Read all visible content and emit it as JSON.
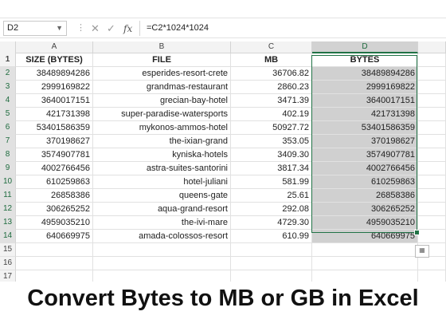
{
  "formula_bar": {
    "name_box": "D2",
    "cancel_icon": "✕",
    "enter_icon": "✓",
    "fx_label": "fx",
    "formula": "=C2*1024*1024"
  },
  "columns": [
    "A",
    "B",
    "C",
    "D"
  ],
  "headers": {
    "a": "SIZE (BYTES)",
    "b": "FILE",
    "c": "MB",
    "d": "BYTES"
  },
  "rows": [
    {
      "n": "2",
      "a": "38489894286",
      "b": "esperides-resort-crete",
      "c": "36706.82",
      "d": "38489894286"
    },
    {
      "n": "3",
      "a": "2999169822",
      "b": "grandmas-restaurant",
      "c": "2860.23",
      "d": "2999169822"
    },
    {
      "n": "4",
      "a": "3640017151",
      "b": "grecian-bay-hotel",
      "c": "3471.39",
      "d": "3640017151"
    },
    {
      "n": "5",
      "a": "421731398",
      "b": "super-paradise-watersports",
      "c": "402.19",
      "d": "421731398"
    },
    {
      "n": "6",
      "a": "53401586359",
      "b": "mykonos-ammos-hotel",
      "c": "50927.72",
      "d": "53401586359"
    },
    {
      "n": "7",
      "a": "370198627",
      "b": "the-ixian-grand",
      "c": "353.05",
      "d": "370198627"
    },
    {
      "n": "8",
      "a": "3574907781",
      "b": "kyniska-hotels",
      "c": "3409.30",
      "d": "3574907781"
    },
    {
      "n": "9",
      "a": "4002766456",
      "b": "astra-suites-santorini",
      "c": "3817.34",
      "d": "4002766456"
    },
    {
      "n": "10",
      "a": "610259863",
      "b": "hotel-juliani",
      "c": "581.99",
      "d": "610259863"
    },
    {
      "n": "11",
      "a": "26858386",
      "b": "queens-gate",
      "c": "25.61",
      "d": "26858386"
    },
    {
      "n": "12",
      "a": "306265252",
      "b": "aqua-grand-resort",
      "c": "292.08",
      "d": "306265252"
    },
    {
      "n": "13",
      "a": "4959035210",
      "b": "the-ivi-mare",
      "c": "4729.30",
      "d": "4959035210"
    },
    {
      "n": "14",
      "a": "640669975",
      "b": "amada-colossos-resort",
      "c": "610.99",
      "d": "640669975"
    }
  ],
  "empty_rows": [
    "15",
    "16",
    "17"
  ],
  "caption": "Convert Bytes to MB or GB in Excel"
}
